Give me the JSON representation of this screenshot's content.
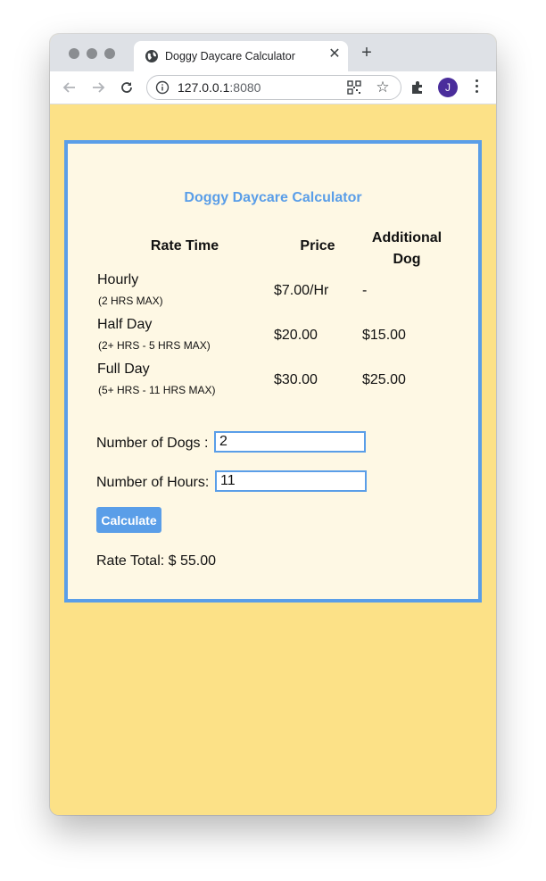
{
  "browser": {
    "tab_title": "Doggy Daycare Calculator",
    "url_host": "127.0.0.1",
    "url_port": ":8080",
    "avatar_initial": "J",
    "icons": [
      "globe-icon",
      "close-icon",
      "plus-icon",
      "back-arrow-icon",
      "forward-arrow-icon",
      "reload-icon",
      "info-icon",
      "qr-code-icon",
      "star-icon",
      "puzzle-extension-icon",
      "more-vert-icon"
    ],
    "colors": {
      "tab_strip": "#dee1e6",
      "avatar": "#4a2d9b"
    }
  },
  "page": {
    "title": "Doggy Daycare Calculator",
    "table": {
      "headers": {
        "rate_time": "Rate Time",
        "price": "Price",
        "additional_line1": "Additional",
        "additional_line2": "Dog"
      },
      "rows": [
        {
          "name": "Hourly",
          "note": "(2 HRS MAX)",
          "price": "$7.00/Hr",
          "additional": "-"
        },
        {
          "name": "Half Day",
          "note": "(2+ HRS - 5 HRS MAX)",
          "price": "$20.00",
          "additional": "$15.00"
        },
        {
          "name": "Full Day",
          "note": "(5+ HRS - 11 HRS MAX)",
          "price": "$30.00",
          "additional": "$25.00"
        }
      ]
    },
    "form": {
      "dogs_label": "Number of Dogs :",
      "dogs_value": "2",
      "hours_label": "Number of Hours:",
      "hours_value": "11",
      "calculate_label": "Calculate"
    },
    "result": "Rate Total: $ 55.00",
    "colors": {
      "background": "#fce187",
      "card": "#fef8e4",
      "accent": "#5a9ee8"
    }
  }
}
